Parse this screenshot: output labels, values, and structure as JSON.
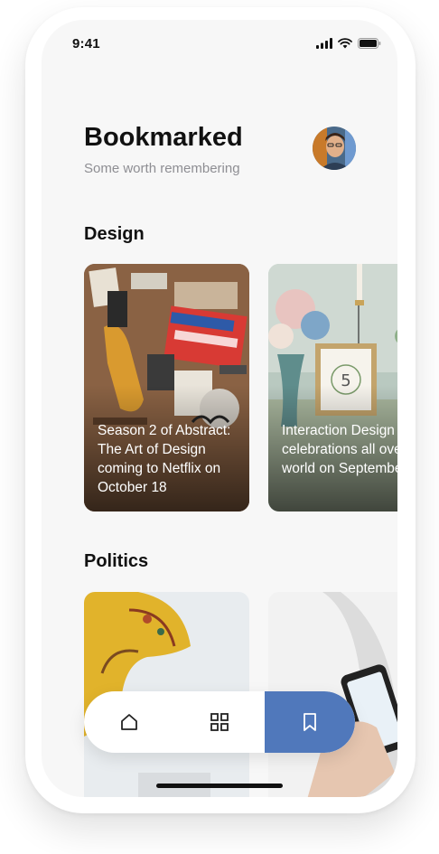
{
  "status_bar": {
    "time": "9:41"
  },
  "header": {
    "title": "Bookmarked",
    "subtitle": "Some worth remembering"
  },
  "sections": [
    {
      "title": "Design",
      "cards": [
        {
          "title": "Season 2 of Abstract: The Art of Design coming to Netflix on October 18"
        },
        {
          "title": "Interaction Design Day celebrations all over the world on September"
        }
      ]
    },
    {
      "title": "Politics",
      "cards": [
        {},
        {}
      ]
    }
  ],
  "tab_bar": {
    "tabs": [
      {
        "icon": "home-icon"
      },
      {
        "icon": "grid-icon"
      },
      {
        "icon": "bookmark-icon",
        "active": true
      }
    ],
    "active_color": "#5078bb"
  },
  "colors": {
    "title": "#111111",
    "subtitle": "#8e8e93",
    "background": "#f7f7f7"
  }
}
